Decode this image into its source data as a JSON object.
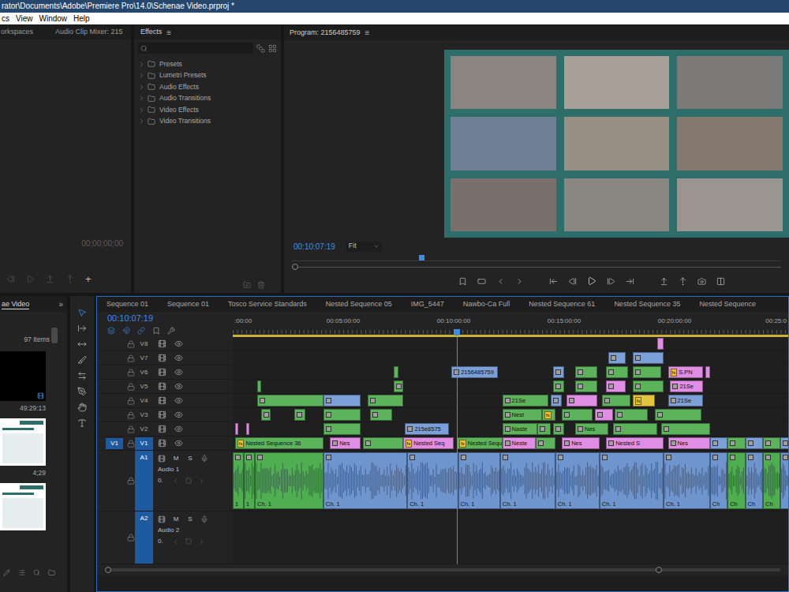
{
  "window": {
    "title": "rator\\Documents\\Adobe\\Premiere Pro\\14.0\\Schenae Video.prproj *"
  },
  "menu": [
    "cs",
    "View",
    "Window",
    "Help"
  ],
  "source_panel": {
    "tabs": [
      "orkspaces",
      "Audio Clip Mixer: 215"
    ],
    "timecode": "00;00;00;00",
    "add": "+"
  },
  "effects_panel": {
    "title": "Effects",
    "menu": "≡",
    "items": [
      {
        "label": "Presets",
        "expanded": false
      },
      {
        "label": "Lumetri Presets",
        "expanded": false
      },
      {
        "label": "Audio Effects",
        "expanded": false
      },
      {
        "label": "Audio Transitions",
        "expanded": false
      },
      {
        "label": "Video Effects",
        "expanded": false
      },
      {
        "label": "Video Transitions",
        "expanded": false
      }
    ]
  },
  "program_monitor": {
    "title": "Program: 2156485759",
    "menu": "≡",
    "timecode": "00:10:07:19",
    "zoom": "Fit",
    "level": 0.26
  },
  "project_panel": {
    "tab": "ae Video",
    "overflow": "»",
    "count": "97 Items",
    "items": [
      {
        "kind": "video",
        "duration": "49:29:13"
      },
      {
        "kind": "slide",
        "duration": "4;29"
      },
      {
        "kind": "slide"
      }
    ]
  },
  "tools": [
    {
      "kind": "selection",
      "selected": true
    },
    {
      "kind": "track-select",
      "selected": false
    },
    {
      "kind": "ripple",
      "selected": false
    },
    {
      "kind": "razor",
      "selected": false
    },
    {
      "kind": "slip",
      "selected": false
    },
    {
      "kind": "pen",
      "selected": false
    },
    {
      "kind": "hand",
      "selected": false
    },
    {
      "kind": "type",
      "selected": false
    }
  ],
  "timeline": {
    "tabs": [
      {
        "label": "Sequence 01",
        "selected": false
      },
      {
        "label": "Sequence 01",
        "selected": false
      },
      {
        "label": "Tosco Service Standards",
        "selected": false
      },
      {
        "label": "Nested Sequence 05",
        "selected": false
      },
      {
        "label": "IMG_5447",
        "selected": false
      },
      {
        "label": "Nawbo-Ca Full",
        "selected": false
      },
      {
        "label": "Nested Sequence 61",
        "selected": false
      },
      {
        "label": "Nested Sequence 35",
        "selected": false
      },
      {
        "label": "Nested Sequence",
        "selected": false
      }
    ],
    "timecode": "00:10:07:19",
    "snap": true,
    "linked": true,
    "ruler": [
      {
        "text": ":00:00",
        "at": 0
      },
      {
        "text": "00:05:00:00",
        "at": 5
      },
      {
        "text": "00:10:00:00",
        "at": 10
      },
      {
        "text": "00:15:00:00",
        "at": 15
      },
      {
        "text": "00:20:00:00",
        "at": 20
      },
      {
        "text": "00:25:0",
        "at": 25
      }
    ],
    "playhead": 10.13,
    "video_tracks": [
      {
        "name": "V8",
        "targeted": false,
        "clips": [
          {
            "start": 19.2,
            "end": 19.5,
            "color": "#e08ee3"
          }
        ]
      },
      {
        "name": "V7",
        "targeted": false,
        "clips": [
          {
            "start": 17.0,
            "end": 17.8,
            "color": "#7b9fd6"
          },
          {
            "start": 18.1,
            "end": 19.5,
            "color": "#7b9fd6"
          }
        ]
      },
      {
        "name": "V6",
        "targeted": false,
        "clips": [
          {
            "start": 7.3,
            "end": 7.5,
            "color": "#5cb35c"
          },
          {
            "start": 9.9,
            "end": 12.0,
            "color": "#7b9fd6",
            "label": "2156485759"
          },
          {
            "start": 14.5,
            "end": 15.0,
            "color": "#7b9fd6"
          },
          {
            "start": 15.5,
            "end": 16.5,
            "color": "#5cb35c"
          },
          {
            "start": 16.9,
            "end": 17.9,
            "color": "#5cb35c"
          },
          {
            "start": 18.1,
            "end": 19.4,
            "color": "#5cb35c"
          },
          {
            "start": 19.7,
            "end": 21.3,
            "color": "#e08ee3",
            "label": "S.PN",
            "badge": "fx"
          },
          {
            "start": 21.4,
            "end": 21.6,
            "color": "#e08ee3"
          }
        ]
      },
      {
        "name": "V5",
        "targeted": false,
        "clips": [
          {
            "start": 1.1,
            "end": 1.3,
            "color": "#5cb35c"
          },
          {
            "start": 7.3,
            "end": 7.7,
            "color": "#5cb35c"
          },
          {
            "start": 14.5,
            "end": 15.0,
            "color": "#5cb35c"
          },
          {
            "start": 15.5,
            "end": 16.5,
            "color": "#5cb35c"
          },
          {
            "start": 16.9,
            "end": 17.8,
            "color": "#e08ee3"
          },
          {
            "start": 18.1,
            "end": 19.5,
            "color": "#5cb35c"
          },
          {
            "start": 19.8,
            "end": 21.3,
            "color": "#e08ee3",
            "label": "21Se"
          }
        ]
      },
      {
        "name": "V4",
        "targeted": false,
        "clips": [
          {
            "start": 1.1,
            "end": 4.1,
            "color": "#5cb35c"
          },
          {
            "start": 4.1,
            "end": 5.8,
            "color": "#7b9fd6"
          },
          {
            "start": 6.1,
            "end": 7.7,
            "color": "#5cb35c"
          },
          {
            "start": 12.2,
            "end": 14.3,
            "color": "#5cb35c",
            "label": "21Se"
          },
          {
            "start": 14.4,
            "end": 14.9,
            "color": "#7b9fd6"
          },
          {
            "start": 15.1,
            "end": 16.5,
            "color": "#e08ee3"
          },
          {
            "start": 16.7,
            "end": 18.0,
            "color": "#5cb35c"
          },
          {
            "start": 18.1,
            "end": 19.1,
            "color": "#e3c43f",
            "badge": "fx"
          },
          {
            "start": 19.7,
            "end": 21.3,
            "color": "#7b9fd6",
            "label": "21Se"
          }
        ]
      },
      {
        "name": "V3",
        "targeted": false,
        "clips": [
          {
            "start": 1.3,
            "end": 1.7,
            "color": "#5cb35c"
          },
          {
            "start": 2.8,
            "end": 3.3,
            "color": "#5cb35c"
          },
          {
            "start": 4.1,
            "end": 5.8,
            "color": "#5cb35c"
          },
          {
            "start": 6.2,
            "end": 7.2,
            "color": "#5cb35c"
          },
          {
            "start": 12.2,
            "end": 14.0,
            "color": "#5cb35c",
            "label": "Nest"
          },
          {
            "start": 14.0,
            "end": 14.6,
            "color": "#5cb35c",
            "badge": "fx"
          },
          {
            "start": 14.9,
            "end": 16.3,
            "color": "#5cb35c"
          },
          {
            "start": 16.4,
            "end": 17.2,
            "color": "#e08ee3"
          },
          {
            "start": 17.3,
            "end": 18.8,
            "color": "#5cb35c"
          },
          {
            "start": 19.1,
            "end": 21.2,
            "color": "#5cb35c"
          }
        ]
      },
      {
        "name": "V2",
        "targeted": false,
        "clips": [
          {
            "start": 0.1,
            "end": 0.25,
            "color": "#e08ee3"
          },
          {
            "start": 0.6,
            "end": 0.75,
            "color": "#e08ee3"
          },
          {
            "start": 4.1,
            "end": 5.8,
            "color": "#5cb35c"
          },
          {
            "start": 7.8,
            "end": 9.8,
            "color": "#7b9fd6",
            "label": "215e8575"
          },
          {
            "start": 12.2,
            "end": 13.8,
            "color": "#5cb35c",
            "label": "Naste"
          },
          {
            "start": 13.8,
            "end": 14.4,
            "color": "#5cb35c"
          },
          {
            "start": 14.5,
            "end": 15.0,
            "color": "#5cb35c"
          },
          {
            "start": 15.5,
            "end": 17.0,
            "color": "#5cb35c",
            "label": "Nes"
          },
          {
            "start": 17.2,
            "end": 19.2,
            "color": "#5cb35c"
          },
          {
            "start": 19.4,
            "end": 21.6,
            "color": "#5cb35c"
          }
        ]
      },
      {
        "name": "V1",
        "targeted": true,
        "source": "V1",
        "clips": [
          {
            "start": 0.1,
            "end": 4.1,
            "color": "#5cb35c",
            "label": "Nested Sequence 36",
            "badge": "fx"
          },
          {
            "start": 4.4,
            "end": 5.8,
            "color": "#e08ee3",
            "label": "Nes"
          },
          {
            "start": 5.9,
            "end": 7.7,
            "color": "#5cb35c"
          },
          {
            "start": 7.7,
            "end": 10.0,
            "color": "#e08ee3",
            "label": "Nested Seq",
            "badge": "fx"
          },
          {
            "start": 10.15,
            "end": 12.2,
            "color": "#5cb35c",
            "label": "Nested Sequ",
            "badge": "fx"
          },
          {
            "start": 12.2,
            "end": 13.7,
            "color": "#e08ee3",
            "label": "Neste"
          },
          {
            "start": 13.7,
            "end": 14.6,
            "color": "#5cb35c"
          },
          {
            "start": 14.9,
            "end": 16.6,
            "color": "#e08ee3",
            "label": "Nes"
          },
          {
            "start": 16.9,
            "end": 19.5,
            "color": "#e08ee3",
            "label": "Nested S"
          },
          {
            "start": 19.7,
            "end": 21.6,
            "color": "#e08ee3",
            "label": "Nes"
          },
          {
            "start": 21.6,
            "end": 22.4,
            "color": "#7b9fd6"
          },
          {
            "start": 22.4,
            "end": 23.2,
            "color": "#5cb35c"
          },
          {
            "start": 23.2,
            "end": 24.0,
            "color": "#7b9fd6"
          },
          {
            "start": 24.0,
            "end": 24.8,
            "color": "#5cb35c"
          },
          {
            "start": 24.8,
            "end": 25.2,
            "color": "#7b9fd6"
          }
        ]
      }
    ],
    "audio_tracks": [
      {
        "name": "A1",
        "label": "Audio 1",
        "targeted": true,
        "mute": "M",
        "solo": "S",
        "volume": "0.",
        "clips": [
          {
            "start": 0.0,
            "end": 0.5,
            "color": "#4fae4f",
            "label": "1"
          },
          {
            "start": 0.5,
            "end": 1.0,
            "color": "#4fae4f",
            "label": "1"
          },
          {
            "start": 1.0,
            "end": 4.1,
            "color": "#4fae4f",
            "label": "Ch. 1"
          },
          {
            "start": 4.1,
            "end": 7.9,
            "color": "#6f95cf",
            "label": "Ch. 1"
          },
          {
            "start": 7.9,
            "end": 10.2,
            "color": "#6f95cf",
            "label": "Ch. 1"
          },
          {
            "start": 10.2,
            "end": 12.1,
            "color": "#6f95cf",
            "label": "Ch. 1"
          },
          {
            "start": 12.1,
            "end": 14.6,
            "color": "#6f95cf",
            "label": "Ch. 1"
          },
          {
            "start": 14.6,
            "end": 16.6,
            "color": "#6f95cf",
            "label": "Ch. 1"
          },
          {
            "start": 16.6,
            "end": 19.5,
            "color": "#6f95cf",
            "label": "Ch. 1"
          },
          {
            "start": 19.5,
            "end": 21.6,
            "color": "#6f95cf",
            "label": "Ch. 1"
          },
          {
            "start": 21.6,
            "end": 22.4,
            "color": "#6f95cf",
            "label": "Ch"
          },
          {
            "start": 22.4,
            "end": 23.2,
            "color": "#4fae4f",
            "label": "Ch"
          },
          {
            "start": 23.2,
            "end": 24.0,
            "color": "#6f95cf",
            "label": "Ch"
          },
          {
            "start": 24.0,
            "end": 24.8,
            "color": "#4fae4f",
            "label": "Ch"
          },
          {
            "start": 24.8,
            "end": 25.2,
            "color": "#6f95cf"
          }
        ]
      },
      {
        "name": "A2",
        "label": "Audio 2",
        "targeted": true,
        "mute": "M",
        "solo": "S",
        "volume": "0.",
        "clips": []
      }
    ]
  }
}
